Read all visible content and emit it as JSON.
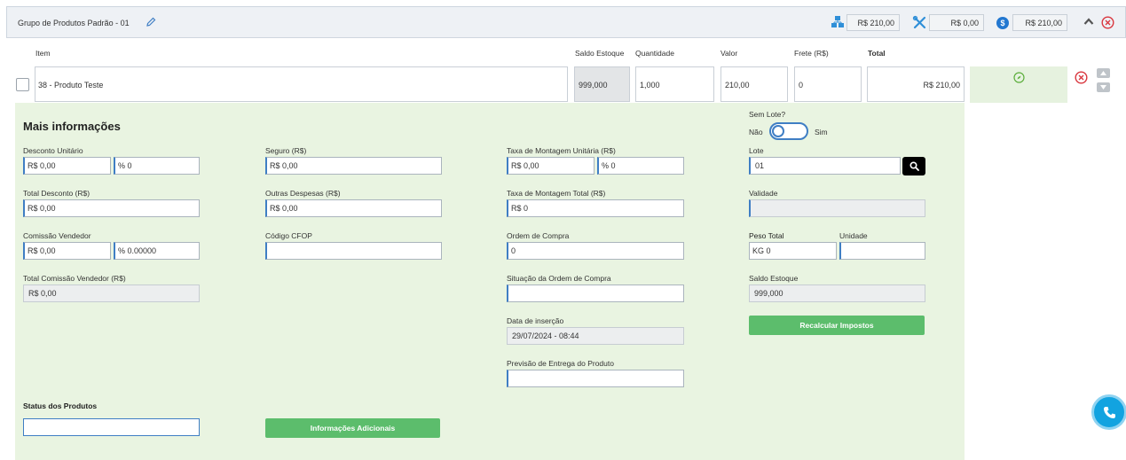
{
  "header": {
    "title": "Grupo de Produtos Padrão - 01",
    "boxes": [
      "R$ 210,00",
      "R$ 0,00",
      "R$ 210,00"
    ],
    "dollar_glyph": "$"
  },
  "columns": {
    "item": "Item",
    "saldo": "Saldo Estoque",
    "quantidade": "Quantidade",
    "valor": "Valor",
    "frete": "Frete (R$)",
    "total": "Total"
  },
  "row": {
    "item": "38 - Produto Teste",
    "saldo": "999,000",
    "quantidade": "1,000",
    "valor": "210,00",
    "frete": "0",
    "total": "R$ 210,00"
  },
  "more": {
    "title": "Mais informações",
    "desconto_unitario": {
      "label": "Desconto Unitário",
      "rs": "R$ 0,00",
      "pct": "% 0"
    },
    "total_desconto": {
      "label": "Total Desconto (R$)",
      "value": "R$ 0,00"
    },
    "comissao_vendedor": {
      "label": "Comissão Vendedor",
      "rs": "R$ 0,00",
      "pct": "% 0.00000"
    },
    "total_comissao": {
      "label": "Total Comissão Vendedor (R$)",
      "value": "R$ 0,00"
    },
    "seguro": {
      "label": "Seguro (R$)",
      "value": "R$ 0,00"
    },
    "outras_despesas": {
      "label": "Outras Despesas (R$)",
      "value": "R$ 0,00"
    },
    "codigo_cfop": {
      "label": "Código CFOP",
      "value": ""
    },
    "taxa_montagem_unitaria": {
      "label": "Taxa de Montagem Unitária (R$)",
      "rs": "R$ 0,00",
      "pct": "% 0"
    },
    "taxa_montagem_total": {
      "label": "Taxa de Montagem Total (R$)",
      "value": "R$ 0"
    },
    "ordem_compra": {
      "label": "Ordem de Compra",
      "value": "0"
    },
    "situacao_ordem": {
      "label": "Situação da Ordem de Compra",
      "value": ""
    },
    "data_insercao": {
      "label": "Data de inserção",
      "value": "29/07/2024 - 08:44"
    },
    "previsao_entrega": {
      "label": "Previsão de Entrega do Produto",
      "value": ""
    },
    "sem_lote": {
      "label": "Sem Lote?",
      "nao": "Não",
      "sim": "Sim"
    },
    "lote": {
      "label": "Lote",
      "value": "01"
    },
    "validade": {
      "label": "Validade",
      "value": ""
    },
    "peso_total": {
      "label": "Peso Total",
      "value": "KG 0"
    },
    "unidade": {
      "label": "Unidade",
      "value": ""
    },
    "saldo_estoque": {
      "label": "Saldo Estoque",
      "value": "999,000"
    },
    "recalcular": "Recalcular Impostos",
    "status_produtos": {
      "label": "Status dos Produtos",
      "value": ""
    },
    "info_adicionais": "Informações Adicionais"
  },
  "colors": {
    "accent": "#3f7ec4",
    "green_button": "#5cbd6c",
    "panel_bg": "#e9f4e1",
    "danger": "#d9363e"
  }
}
